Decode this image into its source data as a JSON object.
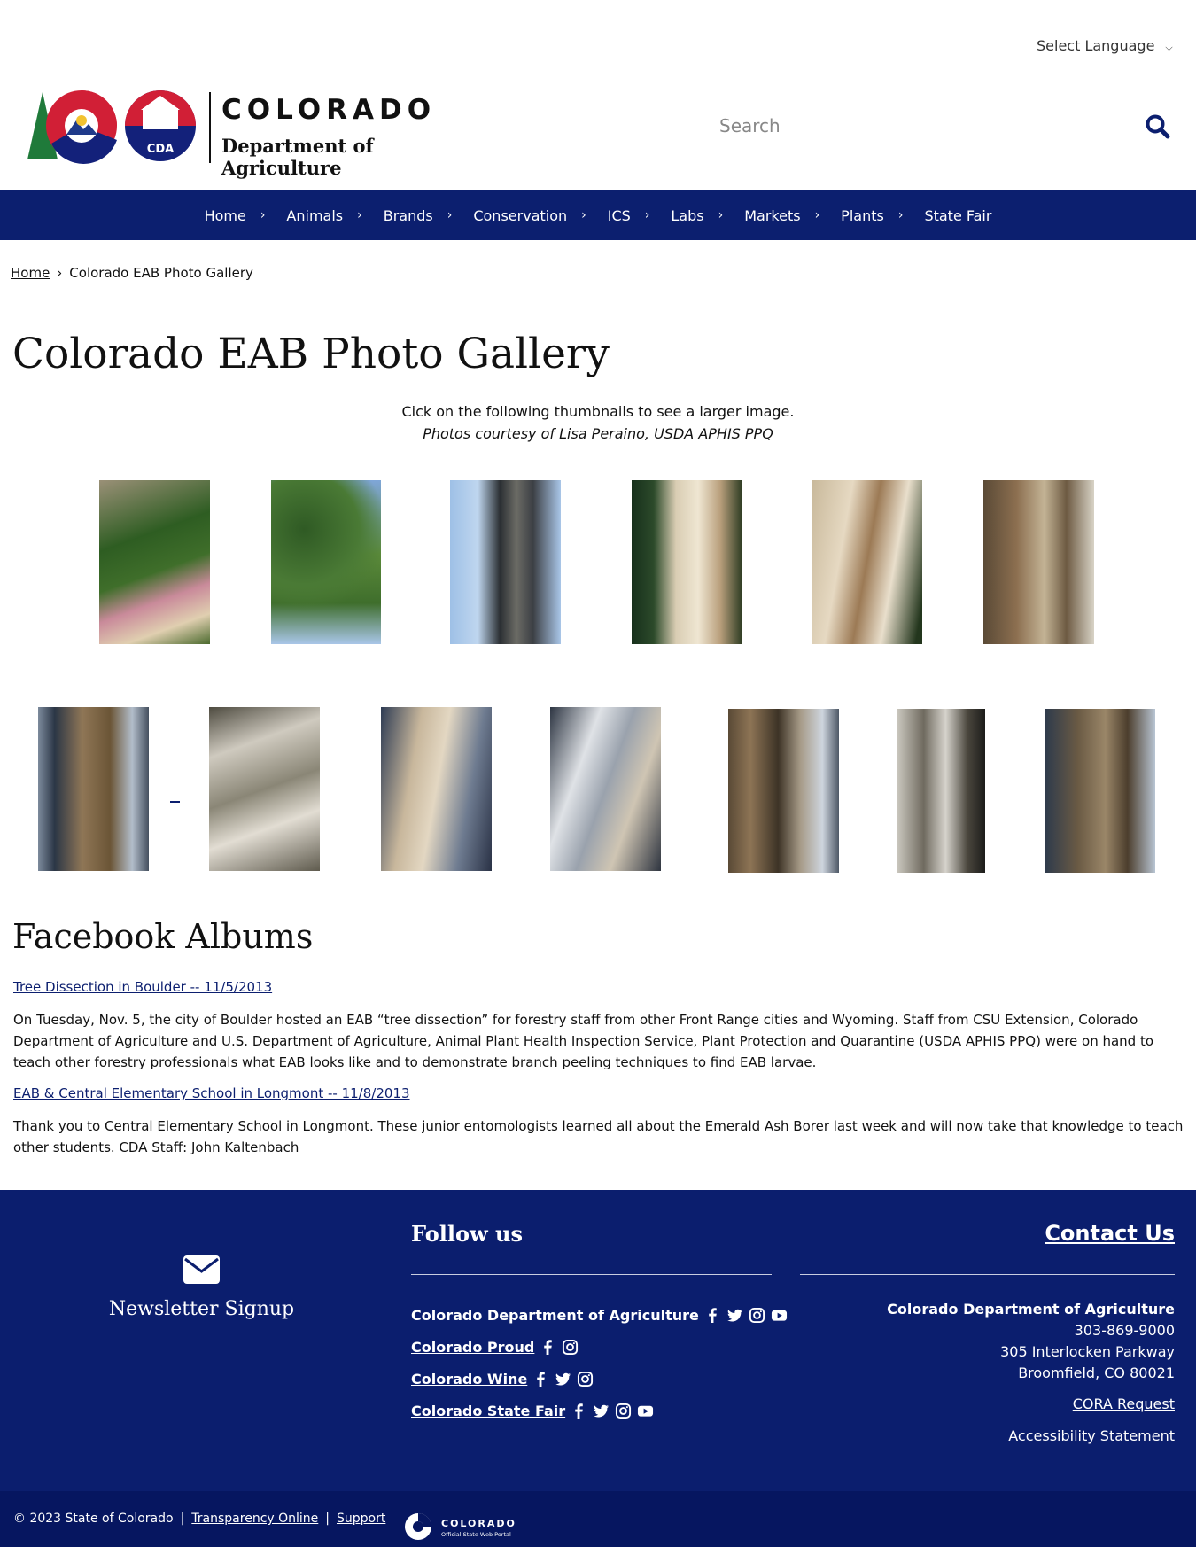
{
  "header": {
    "language": "Select Language",
    "logo_word": "COLORADO",
    "logo_sub": "Department of Agriculture",
    "logo_badge": "CDA",
    "search_placeholder": "Search"
  },
  "nav": [
    "Home",
    "Animals",
    "Brands",
    "Conservation",
    "ICS",
    "Labs",
    "Markets",
    "Plants",
    "State Fair"
  ],
  "breadcrumb": {
    "home": "Home",
    "current": "Colorado EAB Photo Gallery"
  },
  "page": {
    "title": "Colorado EAB Photo Gallery",
    "intro": "Cick on the following thumbnails to see a larger image.",
    "credit": "Photos courtesy of Lisa Peraino, USDA APHIS PPQ"
  },
  "gallery": {
    "row1": [
      "hand holding peeled ash bark",
      "ash tree canopy against sky",
      "tree trunk with branches against sky",
      "peeled trunk showing galleries",
      "close-up of larval galleries",
      "serpentine galleries with pen for scale"
    ],
    "row2": [
      "bark with larval galleries",
      "rough bark surface",
      "peeled bark with damage",
      "bark with exposed wood",
      "damaged bark with galleries",
      "rough bark close-up",
      "bark with serpentine galleries"
    ]
  },
  "facebook": {
    "heading": "Facebook Albums",
    "albums": [
      {
        "link": "Tree Dissection in Boulder -- 11/5/2013",
        "text": "On Tuesday, Nov. 5, the city of Boulder hosted an EAB “tree dissection” for forestry staff from other Front Range cities and Wyoming. Staff from CSU Extension, Colorado Department of Agriculture and U.S. Department of Agriculture, Animal Plant Health Inspection Service, Plant Protection and Quarantine (USDA APHIS PPQ) were on hand to teach other forestry professionals what EAB looks like and to demonstrate branch peeling techniques to find EAB larvae."
      },
      {
        "link": "EAB & Central Elementary School in Longmont -- 11/8/2013",
        "text": "Thank you to Central Elementary School in Longmont. These junior entomologists learned all about the Emerald Ash Borer last week and will now take that knowledge to teach other students. CDA Staff: John Kaltenbach"
      }
    ]
  },
  "footer": {
    "newsletter": "Newsletter Signup",
    "follow_heading": "Follow us",
    "social": [
      {
        "name": "Colorado Department of Agriculture",
        "icons": [
          "facebook-icon",
          "twitter-icon",
          "instagram-icon",
          "youtube-icon"
        ]
      },
      {
        "name": "Colorado Proud",
        "icons": [
          "facebook-icon",
          "instagram-icon"
        ]
      },
      {
        "name": "Colorado Wine",
        "icons": [
          "facebook-icon",
          "twitter-icon",
          "instagram-icon"
        ]
      },
      {
        "name": "Colorado State Fair",
        "icons": [
          "facebook-icon",
          "twitter-icon",
          "instagram-icon",
          "youtube-icon"
        ]
      }
    ],
    "contact_heading": "Contact Us",
    "org": "Colorado Department of Agriculture",
    "phone": "303-869-9000",
    "street": "305 Interlocken Parkway",
    "city": "Broomfield, CO 80021",
    "cora": "CORA Request",
    "accessibility": "Accessibility Statement",
    "copyright": "© 2023 State of Colorado",
    "transparency": "Transparency Online",
    "support": "Support",
    "portal_word": "COLORADO",
    "portal_sub": "Official State Web Portal"
  }
}
